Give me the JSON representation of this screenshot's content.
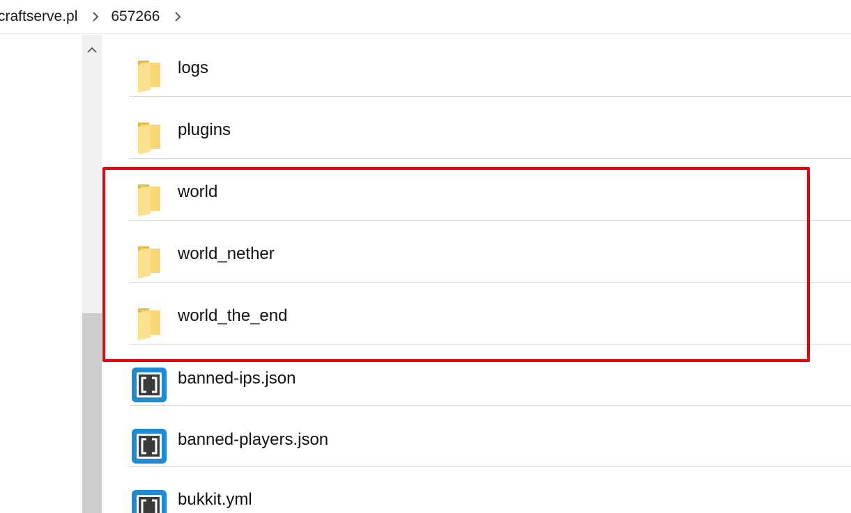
{
  "breadcrumb": {
    "items": [
      {
        "label": "craftserve.pl"
      },
      {
        "label": "657266"
      }
    ]
  },
  "files": [
    {
      "name": "logs",
      "type": "folder",
      "icon": "folder-icon"
    },
    {
      "name": "plugins",
      "type": "folder",
      "icon": "folder-icon"
    },
    {
      "name": "world",
      "type": "folder",
      "icon": "folder-icon"
    },
    {
      "name": "world_nether",
      "type": "folder",
      "icon": "folder-icon"
    },
    {
      "name": "world_the_end",
      "type": "folder",
      "icon": "folder-icon"
    },
    {
      "name": "banned-ips.json",
      "type": "json",
      "icon": "brackets-file-icon"
    },
    {
      "name": "banned-players.json",
      "type": "json",
      "icon": "brackets-file-icon"
    },
    {
      "name": "bukkit.yml",
      "type": "yml",
      "icon": "brackets-file-icon"
    }
  ],
  "colors": {
    "highlight": "#e8000b",
    "folder": "#f8d775",
    "brackets_blue": "#1e8ad4"
  }
}
